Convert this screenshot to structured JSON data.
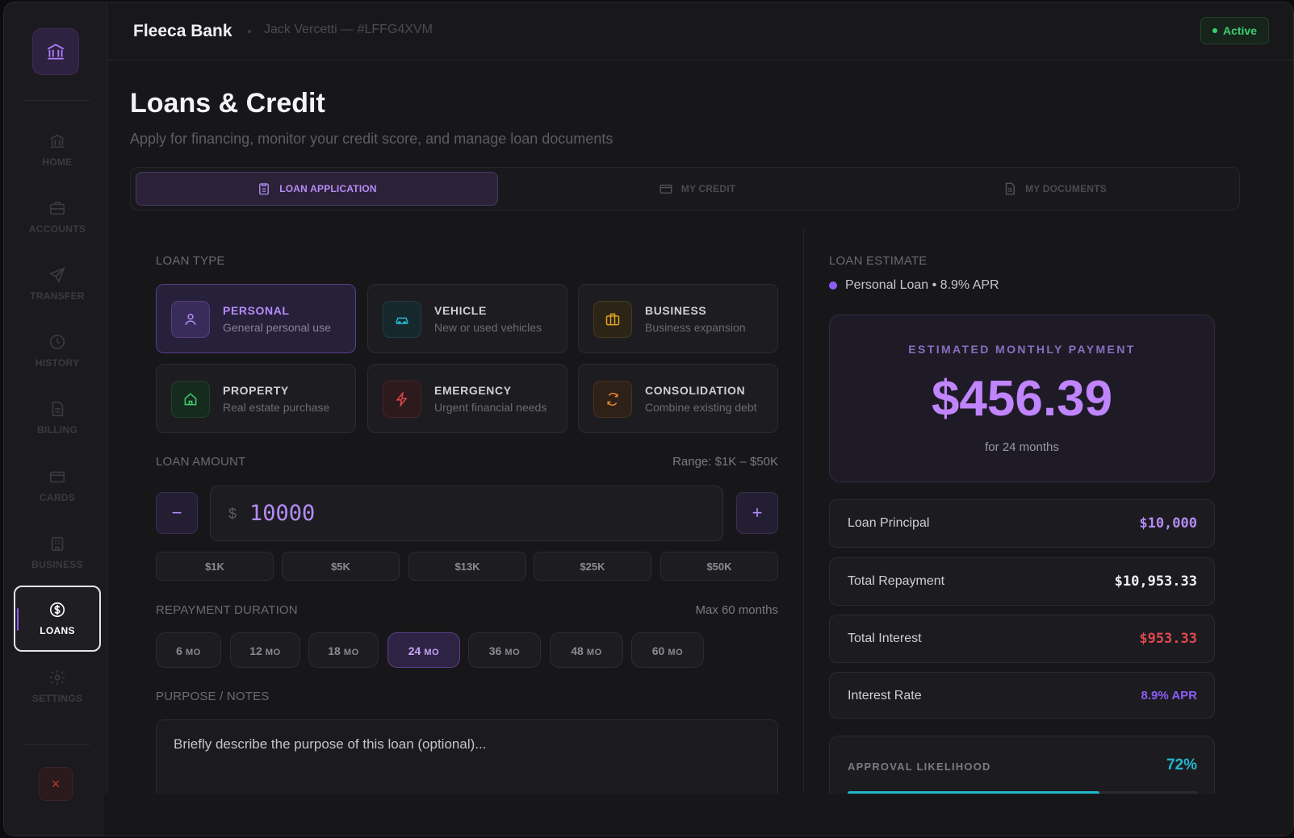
{
  "app": {
    "brand": "Fleeca Bank",
    "user": "Jack Vercetti — #LFFG4XVM",
    "status": "Active",
    "close_label": "×"
  },
  "sidebar": {
    "items": [
      {
        "label": "HOME",
        "icon": "bank-icon"
      },
      {
        "label": "ACCOUNTS",
        "icon": "briefcase-icon"
      },
      {
        "label": "TRANSFER",
        "icon": "send-icon"
      },
      {
        "label": "HISTORY",
        "icon": "clock-icon"
      },
      {
        "label": "BILLING",
        "icon": "document-icon"
      },
      {
        "label": "CARDS",
        "icon": "credit-card-icon"
      },
      {
        "label": "BUSINESS",
        "icon": "building-icon"
      },
      {
        "label": "LOANS",
        "icon": "dollar-circle-icon",
        "active": true
      },
      {
        "label": "SETTINGS",
        "icon": "gear-icon"
      }
    ]
  },
  "page": {
    "title": "Loans & Credit",
    "subtitle": "Apply for financing, monitor your credit score, and manage loan documents"
  },
  "tabs": [
    {
      "label": "LOAN APPLICATION",
      "icon": "clipboard-icon",
      "active": true
    },
    {
      "label": "MY CREDIT",
      "icon": "credit-card-icon"
    },
    {
      "label": "MY DOCUMENTS",
      "icon": "document-icon"
    }
  ],
  "loan_type": {
    "label": "LOAN TYPE",
    "options": [
      {
        "title": "PERSONAL",
        "desc": "General personal use",
        "icon": "user-icon",
        "color": "#8b5cf6",
        "active": true
      },
      {
        "title": "VEHICLE",
        "desc": "New or used vehicles",
        "icon": "car-icon",
        "color": "#22b8cf"
      },
      {
        "title": "BUSINESS",
        "desc": "Business expansion",
        "icon": "briefcase-icon",
        "color": "#e0a526"
      },
      {
        "title": "PROPERTY",
        "desc": "Real estate purchase",
        "icon": "home-icon",
        "color": "#3ecf6f"
      },
      {
        "title": "EMERGENCY",
        "desc": "Urgent financial needs",
        "icon": "lightning-icon",
        "color": "#e0484e"
      },
      {
        "title": "CONSOLIDATION",
        "desc": "Combine existing debt",
        "icon": "refresh-icon",
        "color": "#e8832a"
      }
    ]
  },
  "loan_amount": {
    "label": "LOAN AMOUNT",
    "range": "Range: $1K – $50K",
    "currency": "$",
    "value": "10000",
    "minus": "−",
    "plus": "+",
    "quick": [
      "$1K",
      "$5K",
      "$13K",
      "$25K",
      "$50K"
    ]
  },
  "duration": {
    "label": "REPAYMENT DURATION",
    "max": "Max 60 months",
    "unit": "MO",
    "options": [
      {
        "value": "6"
      },
      {
        "value": "12"
      },
      {
        "value": "18"
      },
      {
        "value": "24",
        "active": true
      },
      {
        "value": "36"
      },
      {
        "value": "48"
      },
      {
        "value": "60"
      }
    ]
  },
  "notes": {
    "label": "PURPOSE / NOTES",
    "placeholder": "Briefly describe the purpose of this loan (optional)..."
  },
  "estimate": {
    "label": "LOAN ESTIMATE",
    "summary": "Personal Loan • 8.9% APR",
    "payment_label": "ESTIMATED MONTHLY PAYMENT",
    "payment": "$456.39",
    "term": "for 24 months",
    "rows": [
      {
        "label": "Loan Principal",
        "value": "$10,000",
        "color": "#b58cf7"
      },
      {
        "label": "Total Repayment",
        "value": "$10,953.33",
        "color": "#f2f2f4"
      },
      {
        "label": "Total Interest",
        "value": "$953.33",
        "color": "#e0484e"
      },
      {
        "label": "Interest Rate",
        "value": "8.9% APR",
        "color": "#8b5cf6"
      }
    ],
    "approval_label": "APPROVAL LIKELIHOOD",
    "approval_value": "72%",
    "approval_fraction": 0.72
  }
}
